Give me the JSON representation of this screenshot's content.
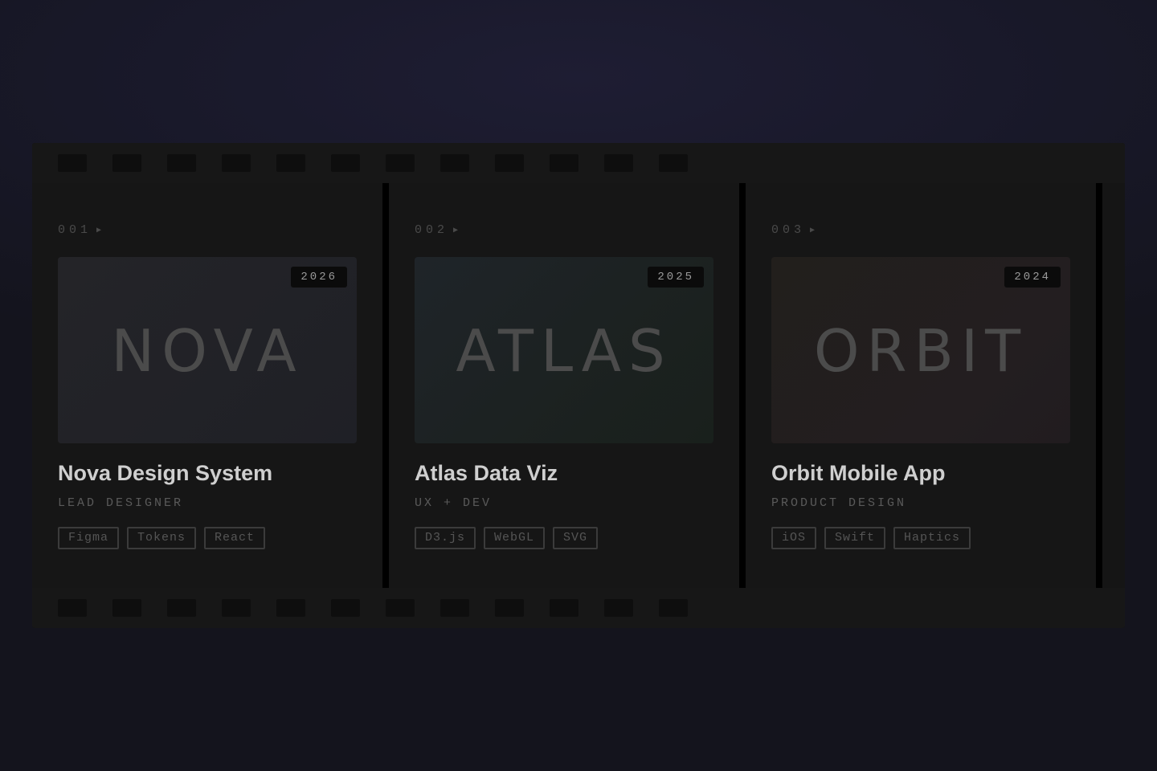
{
  "projects": [
    {
      "index": "001",
      "play_glyph": "▶",
      "thumbnail_word": "NOVA",
      "year": "2026",
      "title": "Nova Design System",
      "role": "LEAD DESIGNER",
      "tags": [
        "Figma",
        "Tokens",
        "React"
      ]
    },
    {
      "index": "002",
      "play_glyph": "▶",
      "thumbnail_word": "ATLAS",
      "year": "2025",
      "title": "Atlas Data Viz",
      "role": "UX + DEV",
      "tags": [
        "D3.js",
        "WebGL",
        "SVG"
      ]
    },
    {
      "index": "003",
      "play_glyph": "▶",
      "thumbnail_word": "ORBIT",
      "year": "2024",
      "title": "Orbit Mobile App",
      "role": "PRODUCT DESIGN",
      "tags": [
        "iOS",
        "Swift",
        "Haptics"
      ]
    }
  ],
  "colors": {
    "background": "#181828",
    "strip": "#151515",
    "divider": "#000000",
    "title_text": "#cfcfcf"
  },
  "icons": {
    "play": "play-icon",
    "perforation": "film-perforation"
  }
}
